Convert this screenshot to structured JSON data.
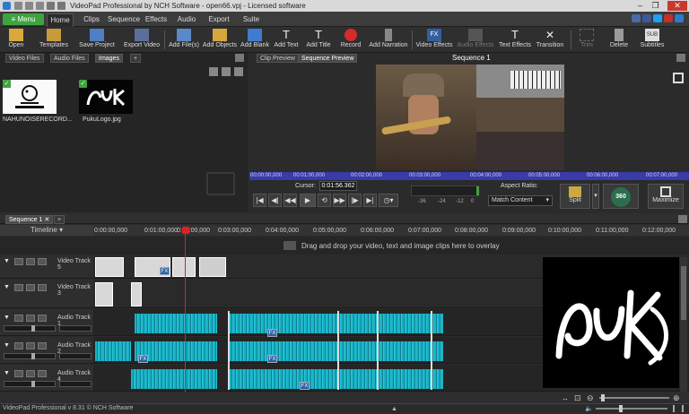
{
  "title_bar": {
    "title": "VideoPad Professional by NCH Software - open66.vpj - Licensed software"
  },
  "menu": {
    "main": "Menu",
    "tabs": [
      "Home",
      "Clips",
      "Sequence",
      "Effects",
      "Audio",
      "Export",
      "Suite"
    ]
  },
  "toolbar": {
    "items": [
      "Open",
      "Templates",
      "Save Project",
      "Export Video",
      "Add File(s)",
      "Add Objects",
      "Add Blank",
      "Add Text",
      "Add Title",
      "Record",
      "Add Narration",
      "Video Effects",
      "Audio Effects",
      "Text Effects",
      "Transition",
      "Trim",
      "Delete",
      "Subtitles"
    ]
  },
  "bin": {
    "tabs": [
      "Video Files",
      "Audio Files",
      "Images"
    ],
    "items": [
      {
        "name": "NAHUNOISERECORD..."
      },
      {
        "name": "PukuLogo.jpg"
      }
    ]
  },
  "preview": {
    "tabs": [
      "Clip Preview",
      "Sequence Preview"
    ],
    "sequence_title": "Sequence 1",
    "ruler": [
      "00:00:00,000",
      "00:01:00,000",
      "00:02:00,000",
      "00:03:00,000",
      "00:04:00,000",
      "00:05:00,000",
      "00:06:00,000",
      "00:07:00,000"
    ],
    "cursor_label": "Cursor:",
    "cursor_value": "0:01:56.362",
    "meter_labels": [
      "-36",
      "-24",
      "-12",
      "0"
    ],
    "aspect_label": "Aspect Ratio:",
    "aspect_value": "Match Content",
    "split": "Split",
    "btn360": "360",
    "maximize": "Maximize"
  },
  "timeline": {
    "seq_tab": "Sequence 1",
    "label": "Timeline",
    "ticks": [
      "0:00:00,000",
      "0:01:00,000",
      "0:02:00,000",
      "0:03:00,000",
      "0:04:00,000",
      "0:05:00,000",
      "0:06:00,000",
      "0:07:00,000",
      "0:08:00,000",
      "0:09:00,000",
      "0:10:00,000",
      "0:11:00,000",
      "0:12:00,000"
    ],
    "drop_hint": "Drag and drop your video, text and image clips here to overlay",
    "tracks": [
      "Video Track 5",
      "Video Track 3",
      "Audio Track 1",
      "Audio Track 2",
      "Audio Track 4"
    ],
    "fx": "FX"
  },
  "status": {
    "text": "VideoPad Professional v 8.31 © NCH Software"
  },
  "colors": {
    "accent": "#3fa33f",
    "ruler": "#3a3aa8",
    "playhead": "#e02020",
    "wave": "#1ab0c4"
  }
}
